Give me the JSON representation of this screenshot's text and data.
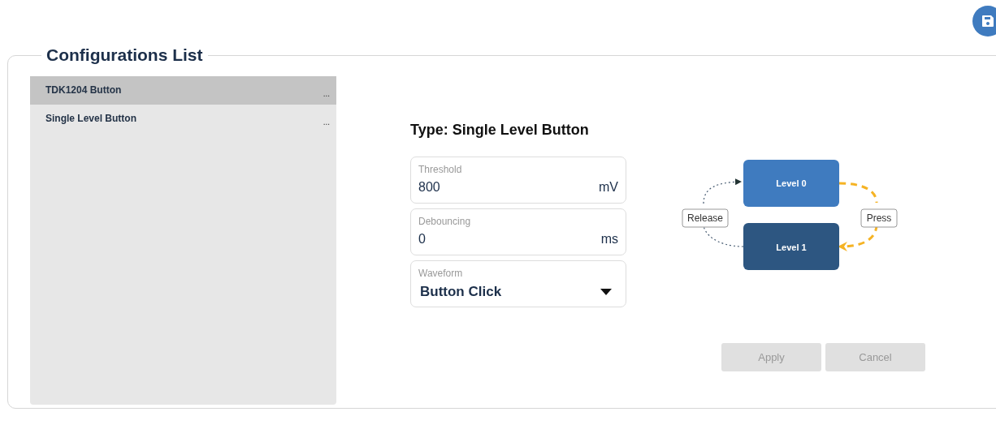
{
  "section_title": "Configurations List",
  "configurations": [
    {
      "name": "TDK1204 Button",
      "menu": "...",
      "selected": true
    },
    {
      "name": "Single Level Button",
      "menu": "...",
      "selected": false
    }
  ],
  "type_title": "Type: Single Level Button",
  "fields": [
    {
      "kind": "number",
      "label": "Threshold",
      "value": "800",
      "unit": "mV"
    },
    {
      "kind": "number",
      "label": "Debouncing",
      "value": "0",
      "unit": "ms"
    },
    {
      "kind": "select",
      "label": "Waveform",
      "value": "Button Click"
    }
  ],
  "diagram": {
    "levels": [
      "Level 0",
      "Level 1"
    ],
    "release_label": "Release",
    "press_label": "Press"
  },
  "buttons": [
    {
      "label": "Apply",
      "disabled": true
    },
    {
      "label": "Cancel",
      "disabled": true
    }
  ]
}
